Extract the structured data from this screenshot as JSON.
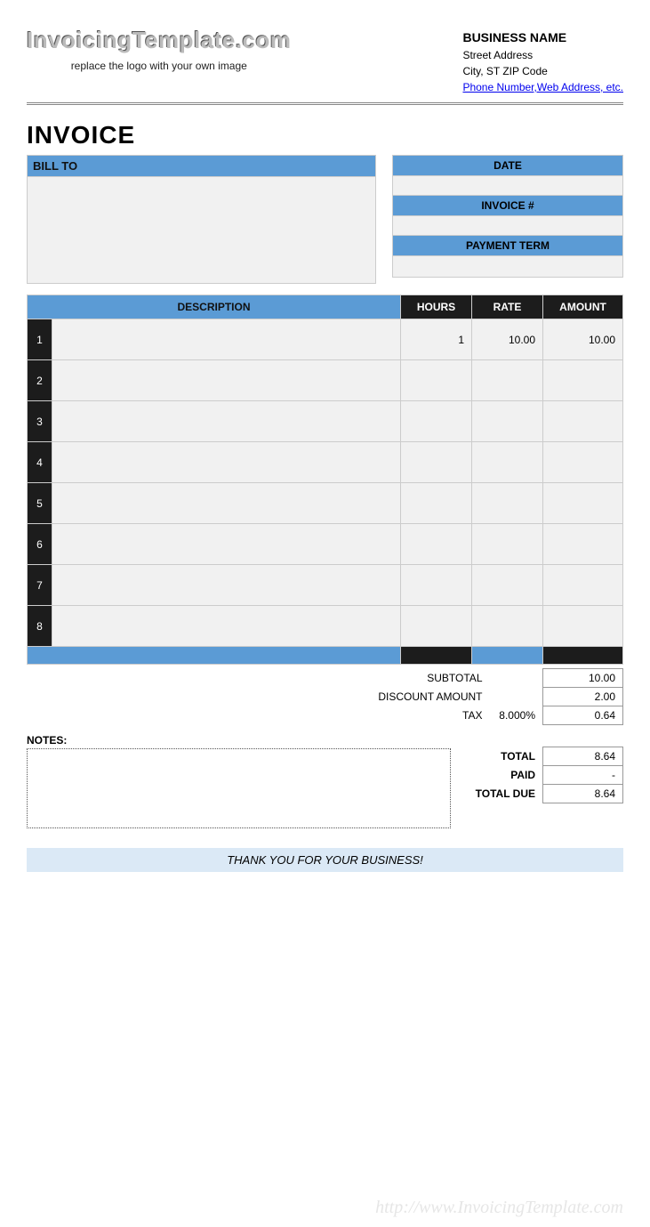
{
  "header": {
    "logo_text": "InvoicingTemplate.com",
    "logo_caption": "replace the logo with your own image",
    "business_name": "BUSINESS NAME",
    "street": "Street Address",
    "city_line": "City, ST  ZIP Code",
    "contact_link": "Phone Number,Web Address, etc."
  },
  "title": "INVOICE",
  "meta": {
    "billto_label": "BILL TO",
    "billto_value": "",
    "date_label": "DATE",
    "date_value": "",
    "invoice_no_label": "INVOICE #",
    "invoice_no_value": "",
    "payment_term_label": "PAYMENT TERM",
    "payment_term_value": ""
  },
  "columns": {
    "description": "DESCRIPTION",
    "hours": "HOURS",
    "rate": "RATE",
    "amount": "AMOUNT"
  },
  "rows": [
    {
      "n": "1",
      "description": "",
      "hours": "1",
      "rate": "10.00",
      "amount": "10.00"
    },
    {
      "n": "2",
      "description": "",
      "hours": "",
      "rate": "",
      "amount": ""
    },
    {
      "n": "3",
      "description": "",
      "hours": "",
      "rate": "",
      "amount": ""
    },
    {
      "n": "4",
      "description": "",
      "hours": "",
      "rate": "",
      "amount": ""
    },
    {
      "n": "5",
      "description": "",
      "hours": "",
      "rate": "",
      "amount": ""
    },
    {
      "n": "6",
      "description": "",
      "hours": "",
      "rate": "",
      "amount": ""
    },
    {
      "n": "7",
      "description": "",
      "hours": "",
      "rate": "",
      "amount": ""
    },
    {
      "n": "8",
      "description": "",
      "hours": "",
      "rate": "",
      "amount": ""
    }
  ],
  "summary": {
    "subtotal_label": "SUBTOTAL",
    "subtotal": "10.00",
    "discount_label": "DISCOUNT AMOUNT",
    "discount": "2.00",
    "tax_label": "TAX",
    "tax_pct": "8.000%",
    "tax": "0.64",
    "total_label": "TOTAL",
    "total": "8.64",
    "paid_label": "PAID",
    "paid": "-",
    "due_label": "TOTAL DUE",
    "due": "8.64"
  },
  "notes_label": "NOTES:",
  "notes_value": "",
  "thanks": "THANK YOU FOR YOUR BUSINESS!",
  "watermark": "http://www.InvoicingTemplate.com"
}
